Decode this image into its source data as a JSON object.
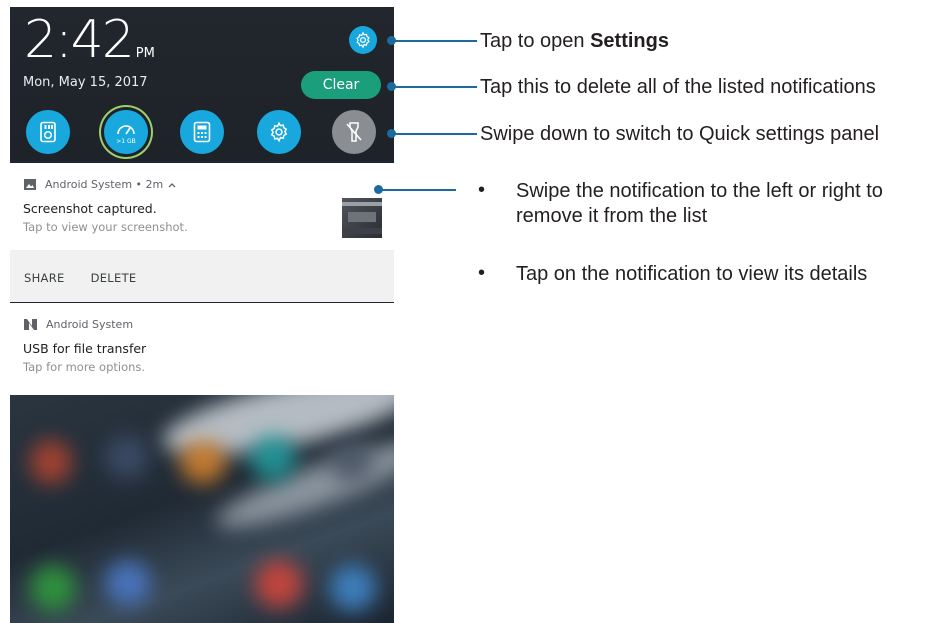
{
  "status": {
    "time": "2:42",
    "ampm": "PM",
    "date": "Mon, May 15, 2017",
    "clear_label": "Clear"
  },
  "quick_settings": {
    "icons": [
      "speaker-icon",
      "boost-icon",
      "calculator-icon",
      "settings-icon",
      "flashlight-off-icon"
    ],
    "boost_label": ">1 GB"
  },
  "notifications": [
    {
      "app": "Android System • 2m",
      "title": "Screenshot captured.",
      "subtitle": "Tap to view your screenshot.",
      "actions": [
        "SHARE",
        "DELETE"
      ]
    },
    {
      "app": "Android System",
      "title": "USB for file transfer",
      "subtitle": "Tap for more options."
    }
  ],
  "callouts": {
    "settings_prefix": "Tap to open ",
    "settings_bold": "Settings",
    "clear": "Tap this to delete all of the listed notifications",
    "quick_settings": "Swipe down to switch to Quick settings panel",
    "bullets": [
      "Swipe the notification to the left or right to remove it from the list",
      "Tap on the notification to view its details"
    ],
    "bullet_mark": "•"
  },
  "colors": {
    "accent_blue": "#19a8de",
    "clear_green": "#1b9e7b",
    "callout_line": "#1b6aa0"
  }
}
